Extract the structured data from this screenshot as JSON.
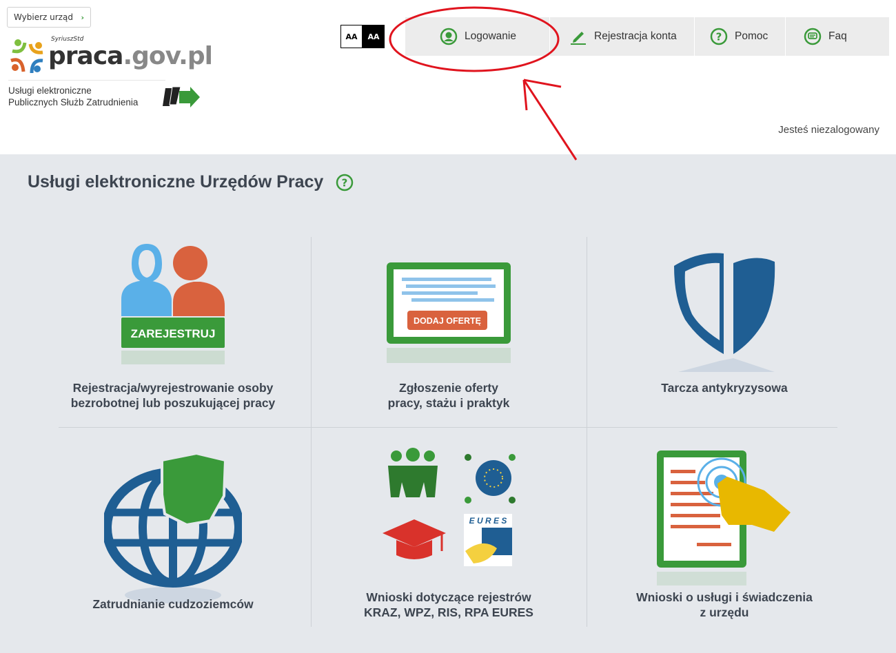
{
  "header": {
    "office_button": "Wybierz urząd",
    "logo_tag": "SyriuszStd",
    "logo_brand_main": "praca",
    "logo_brand_domain": ".gov.pl",
    "logo_sub_line1": "Usługi elektroniczne",
    "logo_sub_line2": "Publicznych Służb Zatrudnienia",
    "font_small": "AA",
    "font_large": "AA",
    "login_status": "Jesteś niezalogowany"
  },
  "nav": {
    "login": "Logowanie",
    "register": "Rejestracja konta",
    "help": "Pomoc",
    "faq": "Faq"
  },
  "main": {
    "title": "Usługi elektroniczne Urzędów Pracy",
    "tiles": [
      {
        "label_line1": "Rejestracja/wyrejestrowanie osoby",
        "label_line2": "bezrobotnej lub poszukującej pracy",
        "badge": "ZAREJESTRUJ"
      },
      {
        "label_line1": "Zgłoszenie oferty",
        "label_line2": "pracy, stażu i praktyk",
        "badge": "DODAJ OFERTĘ"
      },
      {
        "label_line1": "Tarcza antykryzysowa",
        "label_line2": ""
      },
      {
        "label_line1": "Zatrudnianie cudzoziemców",
        "label_line2": ""
      },
      {
        "label_line1": "Wnioski dotyczące rejestrów",
        "label_line2": "KRAZ, WPZ, RIS, RPA EURES",
        "badge": "E U R E S"
      },
      {
        "label_line1": "Wnioski o usługi i świadczenia",
        "label_line2": "z urzędu"
      }
    ]
  },
  "colors": {
    "accent_green": "#3a9a3a",
    "annotation_red": "#e0141e",
    "main_bg": "#e5e8ec",
    "blue": "#1f5e93"
  }
}
